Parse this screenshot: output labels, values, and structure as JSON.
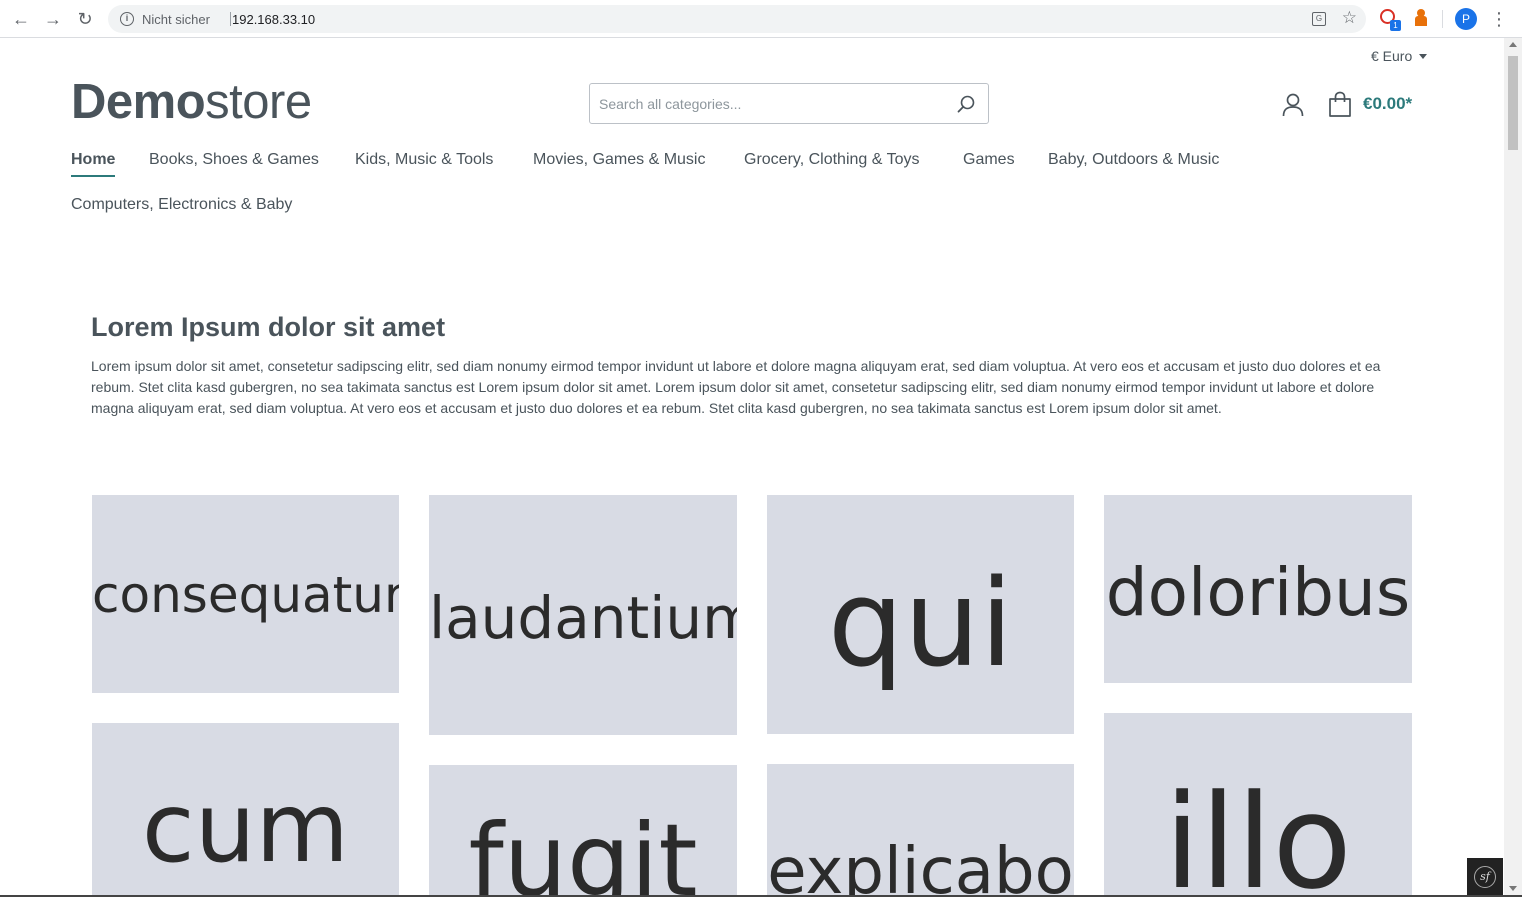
{
  "browser": {
    "security_label": "Nicht sicher",
    "url": "192.168.33.10",
    "profile_initial": "P",
    "extension_badge": "1"
  },
  "header": {
    "currency": "€ Euro",
    "logo_bold": "Demo",
    "logo_light": "store",
    "search_placeholder": "Search all categories...",
    "cart_total": "€0.00*"
  },
  "nav": {
    "items": [
      "Home",
      "Books, Shoes & Games",
      "Kids, Music & Tools",
      "Movies, Games & Music",
      "Grocery, Clothing & Toys",
      "Games",
      "Baby, Outdoors & Music",
      "Computers, Electronics & Baby"
    ],
    "active_index": 0
  },
  "content": {
    "headline": "Lorem Ipsum dolor sit amet",
    "lead": "Lorem ipsum dolor sit amet, consetetur sadipscing elitr, sed diam nonumy eirmod tempor invidunt ut labore et dolore magna aliquyam erat, sed diam voluptua. At vero eos et accusam et justo duo dolores et ea rebum. Stet clita kasd gubergren, no sea takimata sanctus est Lorem ipsum dolor sit amet. Lorem ipsum dolor sit amet, consetetur sadipscing elitr, sed diam nonumy eirmod tempor invidunt ut labore et dolore magna aliquyam erat, sed diam voluptua. At vero eos et accusam et justo duo dolores et ea rebum. Stet clita kasd gubergren, no sea takimata sanctus est Lorem ipsum dolor sit amet."
  },
  "tiles": [
    "consequatur",
    "laudantium",
    "qui",
    "doloribus",
    "cum",
    "fugit",
    "explicabo",
    "illo"
  ],
  "colors": {
    "accent": "#2c7a7b",
    "text": "#4a545b",
    "tile_bg": "#d8dbe4"
  },
  "icons": {
    "search": "search-icon",
    "account": "user-icon",
    "cart": "shopping-bag-icon"
  }
}
